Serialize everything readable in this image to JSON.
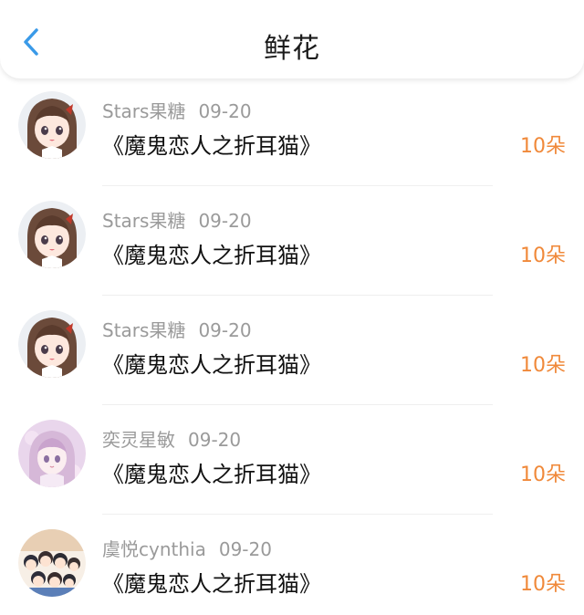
{
  "header": {
    "title": "鲜花"
  },
  "colors": {
    "accent_blue": "#3a9ae8",
    "count_orange": "#f0893a",
    "meta_gray": "#9a9a9a"
  },
  "items": [
    {
      "user": "Stars果糖",
      "date": "09-20",
      "title": "《魔鬼恋人之折耳猫》",
      "count": "10朵",
      "avatar_icon": "anime-girl-brown-hair-avatar"
    },
    {
      "user": "Stars果糖",
      "date": "09-20",
      "title": "《魔鬼恋人之折耳猫》",
      "count": "10朵",
      "avatar_icon": "anime-girl-brown-hair-avatar"
    },
    {
      "user": "Stars果糖",
      "date": "09-20",
      "title": "《魔鬼恋人之折耳猫》",
      "count": "10朵",
      "avatar_icon": "anime-girl-brown-hair-avatar"
    },
    {
      "user": "奕灵星敏",
      "date": "09-20",
      "title": "《魔鬼恋人之折耳猫》",
      "count": "10朵",
      "avatar_icon": "anime-girl-pink-avatar"
    },
    {
      "user": "虞悦cynthia",
      "date": "09-20",
      "title": "《魔鬼恋人之折耳猫》",
      "count": "10朵",
      "avatar_icon": "chibi-group-avatar"
    }
  ]
}
